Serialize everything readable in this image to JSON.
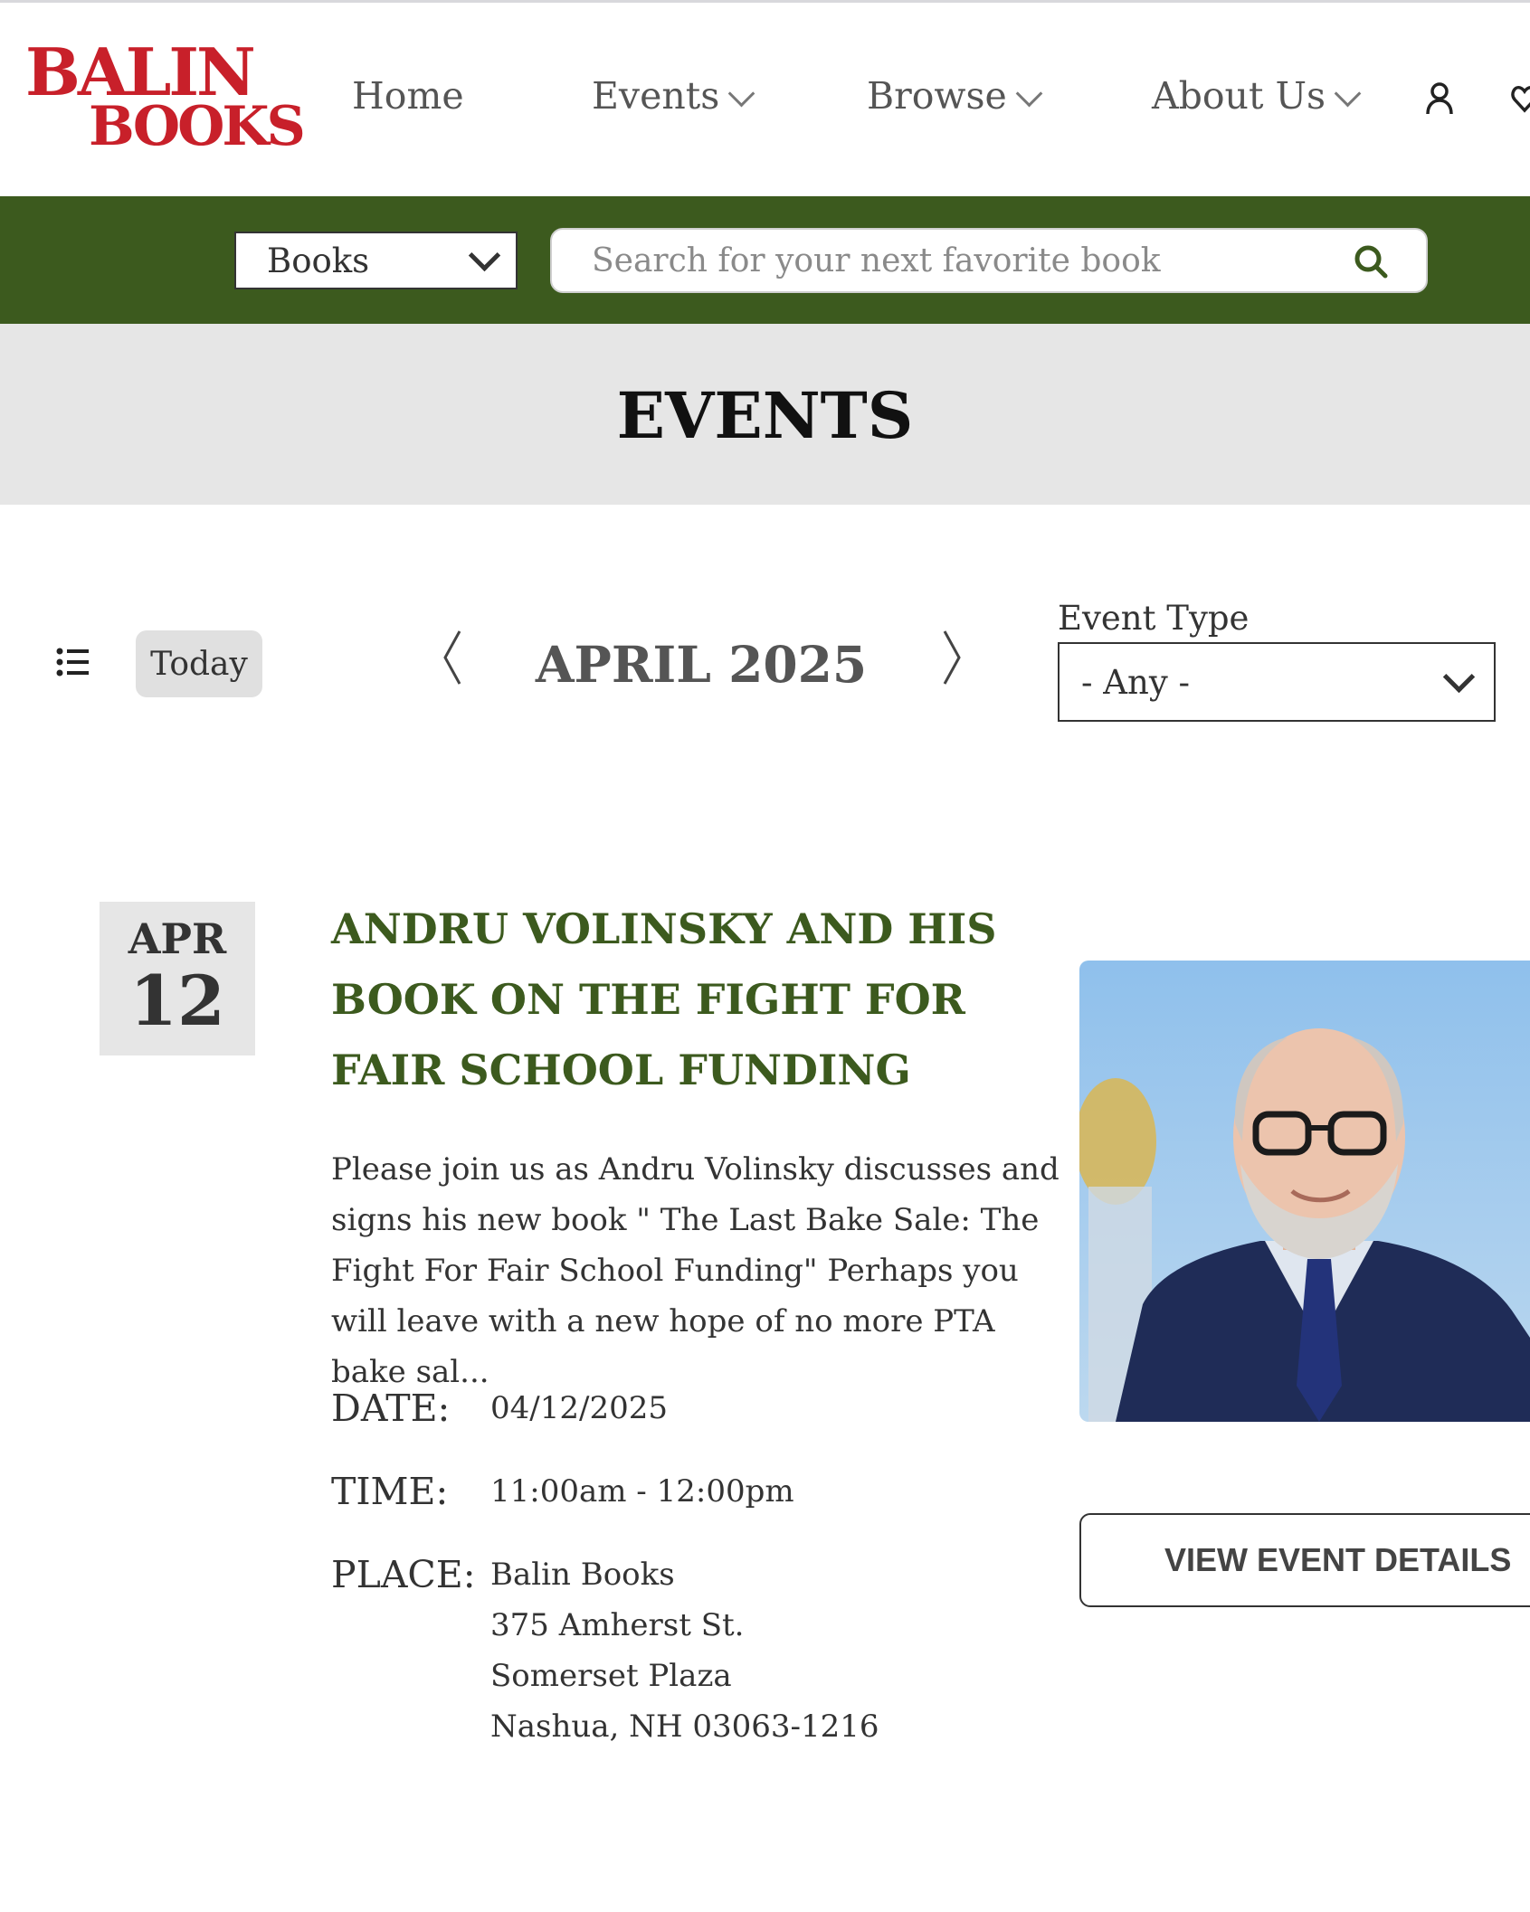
{
  "header": {
    "logo_line1": "BALIN",
    "logo_line2": "BOOKS",
    "nav": [
      {
        "label": "Home"
      },
      {
        "label": "Events"
      },
      {
        "label": "Browse"
      },
      {
        "label": "About Us"
      }
    ]
  },
  "search": {
    "category": "Books",
    "placeholder": "Search for your next favorite book"
  },
  "page": {
    "title": "EVENTS"
  },
  "controls": {
    "today_label": "Today",
    "month_label": "APRIL 2025",
    "event_type_label": "Event Type",
    "event_type_value": "- Any -"
  },
  "event": {
    "badge_month": "APR",
    "badge_day": "12",
    "title": "ANDRU VOLINSKY AND HIS BOOK ON THE FIGHT FOR FAIR SCHOOL FUNDING",
    "description": " Please join us as Andru Volinsky discusses and signs his new book \" The Last Bake Sale: The Fight For Fair School Funding\"  Perhaps you will leave with a new hope of no more PTA bake sal...",
    "date_label": "DATE:",
    "date_value": "04/12/2025",
    "time_label": "TIME:",
    "time_value": "11:00am - 12:00pm",
    "place_label": "PLACE:",
    "place_lines": [
      "Balin Books",
      "375 Amherst St.",
      "Somerset Plaza",
      "Nashua, NH 03063-1216"
    ],
    "details_button": "VIEW EVENT DETAILS"
  },
  "colors": {
    "brand_red": "#c8202a",
    "brand_green": "#3c5a1e",
    "band_gray": "#e6e6e6"
  }
}
